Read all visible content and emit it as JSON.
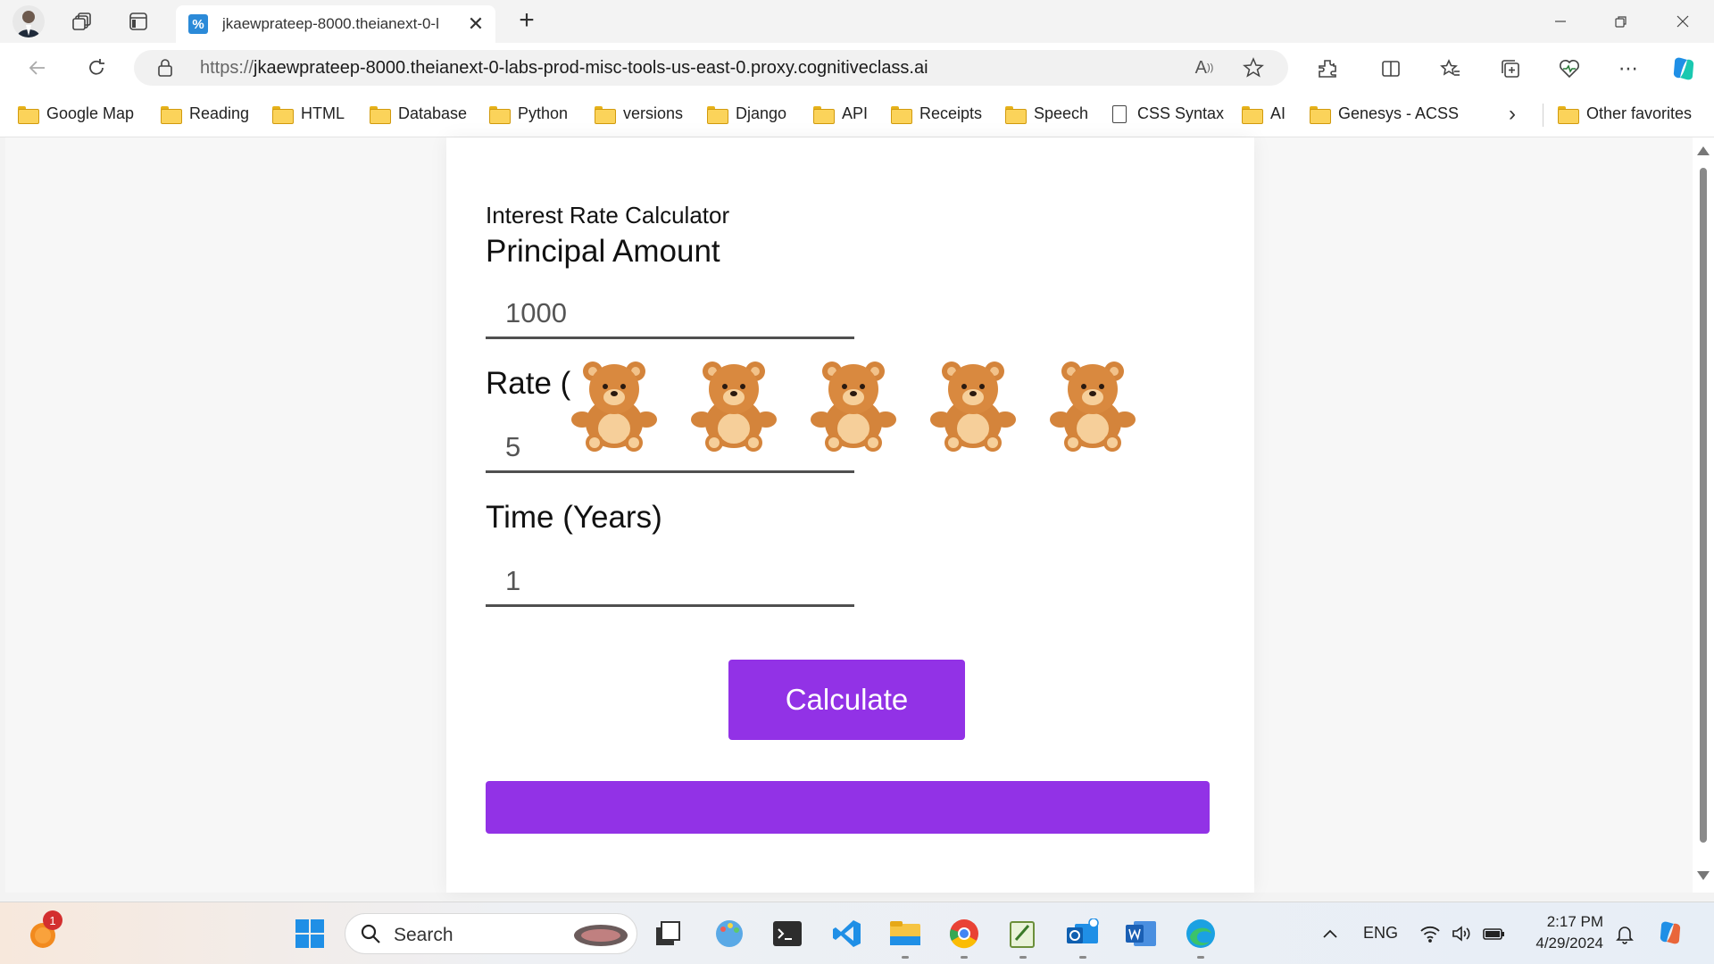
{
  "browser": {
    "tab": {
      "title": "jkaewprateep-8000.theianext-0-l",
      "favicon": "%"
    },
    "url_protocol": "https://",
    "url_rest": "jkaewprateep-8000.theianext-0-labs-prod-misc-tools-us-east-0.proxy.cognitiveclass.ai",
    "favorites": [
      {
        "label": "Google Map",
        "icon": "folder-icon"
      },
      {
        "label": "Reading",
        "icon": "folder-icon"
      },
      {
        "label": "HTML",
        "icon": "folder-icon"
      },
      {
        "label": "Database",
        "icon": "folder-icon"
      },
      {
        "label": "Python",
        "icon": "folder-icon"
      },
      {
        "label": "versions",
        "icon": "folder-icon"
      },
      {
        "label": "Django",
        "icon": "folder-icon"
      },
      {
        "label": "API",
        "icon": "folder-icon"
      },
      {
        "label": "Receipts",
        "icon": "folder-icon"
      },
      {
        "label": "Speech",
        "icon": "folder-icon"
      },
      {
        "label": "CSS Syntax",
        "icon": "document-icon"
      },
      {
        "label": "AI",
        "icon": "folder-icon"
      },
      {
        "label": "Genesys - ACSS",
        "icon": "folder-icon"
      }
    ],
    "other_favorites": "Other favorites"
  },
  "app": {
    "title": "Interest Rate Calculator",
    "principal_label": "Principal Amount",
    "principal_value": "1000",
    "rate_label": "Rate (%)",
    "rate_label_visible": "Rate (",
    "rate_value": "5",
    "time_label": "Time (Years)",
    "time_value": "1",
    "calculate_label": "Calculate",
    "bear_count": 5,
    "accent_color": "#9232e6"
  },
  "taskbar": {
    "search_label": "Search",
    "notification_badge": "1",
    "language": "ENG",
    "time": "2:17 PM",
    "date": "4/29/2024"
  }
}
